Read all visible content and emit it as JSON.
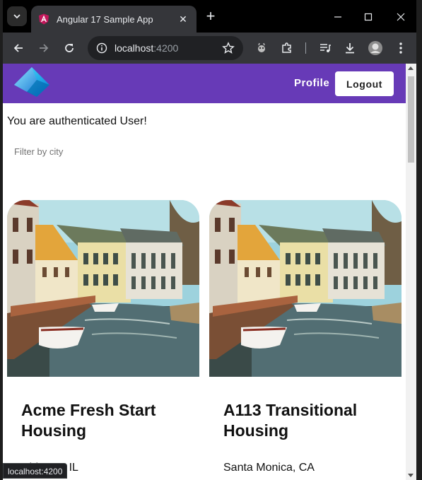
{
  "browser": {
    "tab_title": "Angular 17 Sample App",
    "url_host": "localhost",
    "url_port": ":4200",
    "status_url": "localhost:4200"
  },
  "app": {
    "nav": {
      "profile_label": "Profile",
      "logout_label": "Logout"
    },
    "auth_message": "You are authenticated User!",
    "filter_placeholder": "Filter by city",
    "listings": [
      {
        "name": "Acme Fresh Start Housing",
        "location": "Chicago, IL"
      },
      {
        "name": "A113 Transitional Housing",
        "location": "Santa Monica, CA"
      }
    ]
  },
  "colors": {
    "appbar": "#673ab7",
    "browser_dark": "#35363a"
  }
}
